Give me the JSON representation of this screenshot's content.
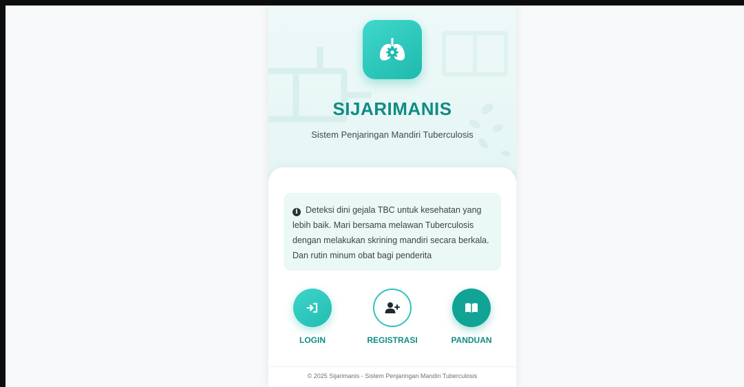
{
  "app": {
    "title": "SIJARIMANIS",
    "subtitle": "Sistem Penjaringan Mandiri Tuberculosis"
  },
  "info": {
    "text": "Deteksi dini gejala TBC untuk kesehatan yang lebih baik. Mari bersama melawan Tuberculosis dengan melakukan skrining mandiri secara berkala. Dan rutin minum obat bagi penderita"
  },
  "actions": {
    "login_label": "LOGIN",
    "register_label": "REGISTRASI",
    "guide_label": "PANDUAN"
  },
  "footer": {
    "text": "© 2025 Sijarimanis - Sistem Penjaringan Mandiri Tuberculosis"
  },
  "colors": {
    "primary": "#1fb9ad",
    "primary_dark": "#0f8c84",
    "info_bg": "#eaf8f6"
  },
  "icons": {
    "logo": "lungs-gear-icon",
    "info": "info-circle-icon",
    "login": "sign-in-icon",
    "register": "user-plus-icon",
    "guide": "book-open-icon"
  }
}
